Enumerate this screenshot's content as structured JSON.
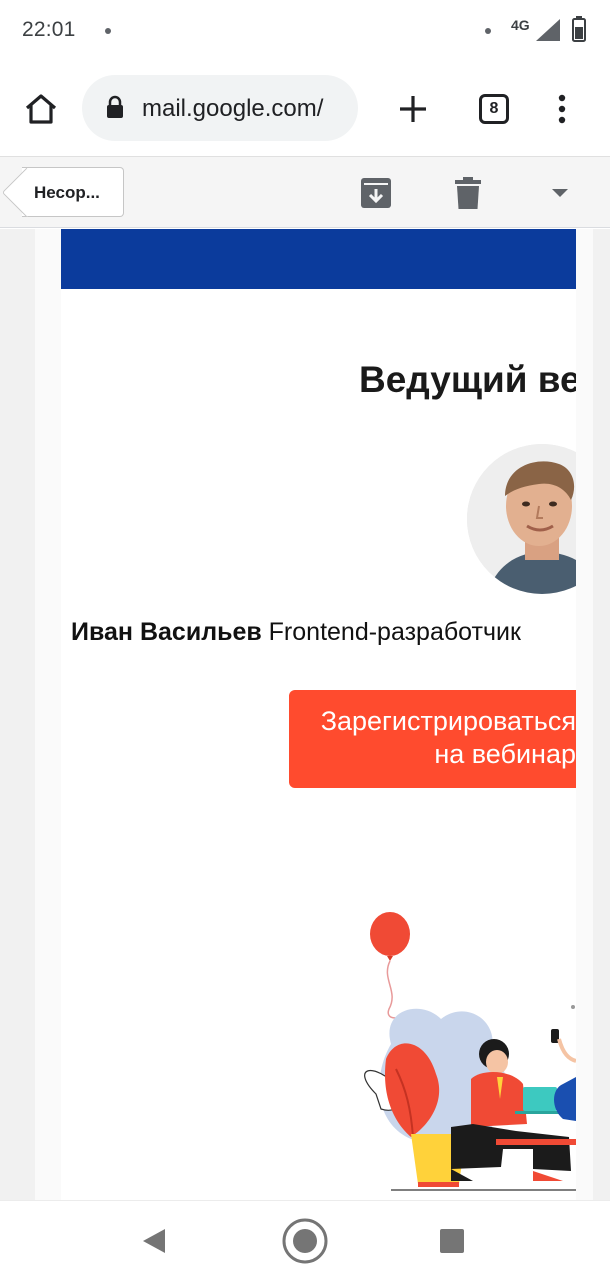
{
  "status_bar": {
    "time": "22:01",
    "network": "4G",
    "icons": [
      "notification-dot-icon",
      "signal-icon",
      "battery-icon"
    ]
  },
  "browser": {
    "url": "mail.google.com/",
    "tab_count": "8",
    "icons": [
      "home-icon",
      "lock-icon",
      "new-tab-icon",
      "tabs-icon",
      "overflow-menu-icon"
    ]
  },
  "mail_toolbar": {
    "back_label": "Несор...",
    "icons": [
      "archive-icon",
      "delete-icon",
      "dropdown-icon"
    ]
  },
  "email": {
    "heading": "Ведущий вебинара",
    "speaker_name": "Иван Васильев",
    "speaker_role": " Frontend-разработчик",
    "cta_line1": "Зарегистрироваться",
    "cta_line2": "на вебинар",
    "colors": {
      "banner": "#0b3b9c",
      "cta": "#ff4b2e"
    }
  },
  "navigation": {
    "icons": [
      "back-icon",
      "home-icon",
      "recents-icon"
    ]
  }
}
